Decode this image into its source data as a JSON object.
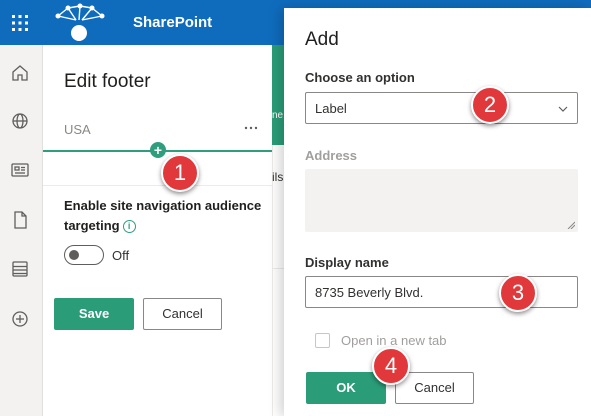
{
  "suitebar": {
    "app_name": "SharePoint",
    "brand_color": "#0f6cbd",
    "waffle_icon": "waffle-icon",
    "logo_icon": "site-logo-network-icon"
  },
  "rail": {
    "icons": [
      "home-icon",
      "globe-icon",
      "news-icon",
      "document-icon",
      "list-icon",
      "add-circle-icon"
    ]
  },
  "edit_footer": {
    "title": "Edit footer",
    "nav_item_label": "USA",
    "more_icon": "more-options-icon",
    "insert_icon": "plus-icon",
    "targeting_label": "Enable site navigation audience targeting",
    "info_icon": "info-icon",
    "toggle_state": "Off",
    "save_label": "Save",
    "cancel_label": "Cancel",
    "accent_color": "#2a9d78"
  },
  "background_page": {
    "fragment_1": "ne",
    "fragment_2": "ils"
  },
  "add_dialog": {
    "title": "Add",
    "option_label": "Choose an option",
    "option_value": "Label",
    "address_label": "Address",
    "display_name_label": "Display name",
    "display_name_value": "8735 Beverly Blvd.",
    "new_tab_label": "Open in a new tab",
    "ok_label": "OK",
    "cancel_label": "Cancel"
  },
  "annotations": {
    "badge_1": "1",
    "badge_2": "2",
    "badge_3": "3",
    "badge_4": "4",
    "badge_color": "#e0383b"
  }
}
